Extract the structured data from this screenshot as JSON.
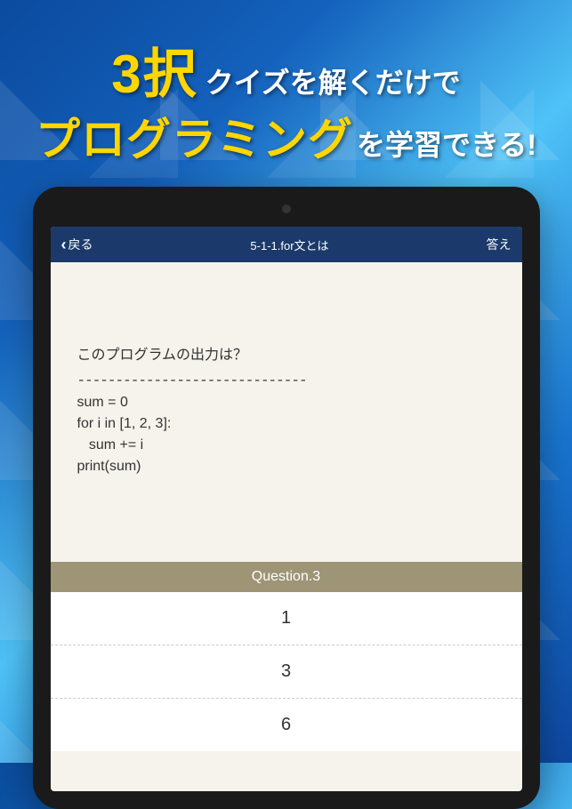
{
  "headline": {
    "highlight1": "3択",
    "text1": "クイズを解くだけで",
    "highlight2": "プログラミング",
    "text2": "を学習できる!"
  },
  "nav": {
    "back_label": "戻る",
    "title": "5-1-1.for文とは",
    "answer_label": "答え"
  },
  "question": {
    "prompt": "このプログラムの出力は？",
    "divider": "------------------------------",
    "code": "sum = 0\nfor i in [1, 2, 3]:\n   sum += i\nprint(sum)"
  },
  "question_label": "Question.3",
  "options": [
    "1",
    "3",
    "6"
  ]
}
